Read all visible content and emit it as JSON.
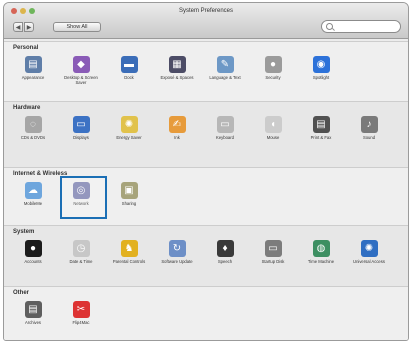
{
  "window": {
    "title": "System Preferences"
  },
  "toolbar": {
    "back_label": "◀",
    "forward_label": "▶",
    "show_all_label": "Show All",
    "search_placeholder": ""
  },
  "sections": [
    {
      "title": "Personal",
      "items": [
        {
          "label": "Appearance",
          "icon": "appearance-icon",
          "glyph": "▤",
          "color": "#5f7ea8"
        },
        {
          "label": "Desktop & Screen Saver",
          "icon": "desktop-icon",
          "glyph": "◆",
          "color": "#8a5bb7"
        },
        {
          "label": "Dock",
          "icon": "dock-icon",
          "glyph": "▬",
          "color": "#3b6db8"
        },
        {
          "label": "Exposé & Spaces",
          "icon": "expose-icon",
          "glyph": "▦",
          "color": "#4c4c66"
        },
        {
          "label": "Language & Text",
          "icon": "language-icon",
          "glyph": "✎",
          "color": "#6d98c6"
        },
        {
          "label": "Security",
          "icon": "security-icon",
          "glyph": "●",
          "color": "#9b9b9b"
        },
        {
          "label": "Spotlight",
          "icon": "spotlight-icon",
          "glyph": "◉",
          "color": "#2d72d9"
        }
      ]
    },
    {
      "title": "Hardware",
      "items": [
        {
          "label": "CDs & DVDs",
          "icon": "cds-dvds-icon",
          "glyph": "◌",
          "color": "#a6a6a6"
        },
        {
          "label": "Displays",
          "icon": "displays-icon",
          "glyph": "▭",
          "color": "#3c72c4"
        },
        {
          "label": "Energy Saver",
          "icon": "energy-saver-icon",
          "glyph": "✺",
          "color": "#e1c24b"
        },
        {
          "label": "Ink",
          "icon": "ink-icon",
          "glyph": "✍",
          "color": "#e79b3b"
        },
        {
          "label": "Keyboard",
          "icon": "keyboard-icon",
          "glyph": "▭",
          "color": "#b7b7b7"
        },
        {
          "label": "Mouse",
          "icon": "mouse-icon",
          "glyph": "◖",
          "color": "#cccccc"
        },
        {
          "label": "Print & Fax",
          "icon": "print-fax-icon",
          "glyph": "▤",
          "color": "#515151"
        },
        {
          "label": "Sound",
          "icon": "sound-icon",
          "glyph": "♪",
          "color": "#7a7a7a"
        }
      ]
    },
    {
      "title": "Internet & Wireless",
      "items": [
        {
          "label": "MobileMe",
          "icon": "mobileme-icon",
          "glyph": "☁",
          "color": "#6ea6dd"
        },
        {
          "label": "Network",
          "icon": "network-icon",
          "glyph": "◎",
          "color": "#7a7dae"
        },
        {
          "label": "Sharing",
          "icon": "sharing-icon",
          "glyph": "▣",
          "color": "#a7a47b"
        }
      ]
    },
    {
      "title": "System",
      "items": [
        {
          "label": "Accounts",
          "icon": "accounts-icon",
          "glyph": "●",
          "color": "#1c1c1c"
        },
        {
          "label": "Date & Time",
          "icon": "date-time-icon",
          "glyph": "◷",
          "color": "#c7c7c7"
        },
        {
          "label": "Parental Controls",
          "icon": "parental-controls-icon",
          "glyph": "♞",
          "color": "#e2b120"
        },
        {
          "label": "Software Update",
          "icon": "software-update-icon",
          "glyph": "↻",
          "color": "#6d8fc7"
        },
        {
          "label": "Speech",
          "icon": "speech-icon",
          "glyph": "♦",
          "color": "#3a3a3a"
        },
        {
          "label": "Startup Disk",
          "icon": "startup-disk-icon",
          "glyph": "▭",
          "color": "#7c7c7c"
        },
        {
          "label": "Time Machine",
          "icon": "time-machine-icon",
          "glyph": "◍",
          "color": "#3d8f62"
        },
        {
          "label": "Universal Access",
          "icon": "universal-access-icon",
          "glyph": "✺",
          "color": "#2f6ec2"
        }
      ]
    },
    {
      "title": "Other",
      "items": [
        {
          "label": "Archives",
          "icon": "archives-icon",
          "glyph": "▤",
          "color": "#5f5f5f"
        },
        {
          "label": "Flip4Mac",
          "icon": "flip4mac-icon",
          "glyph": "✂",
          "color": "#d33"
        }
      ]
    }
  ],
  "selected_item": "Network"
}
